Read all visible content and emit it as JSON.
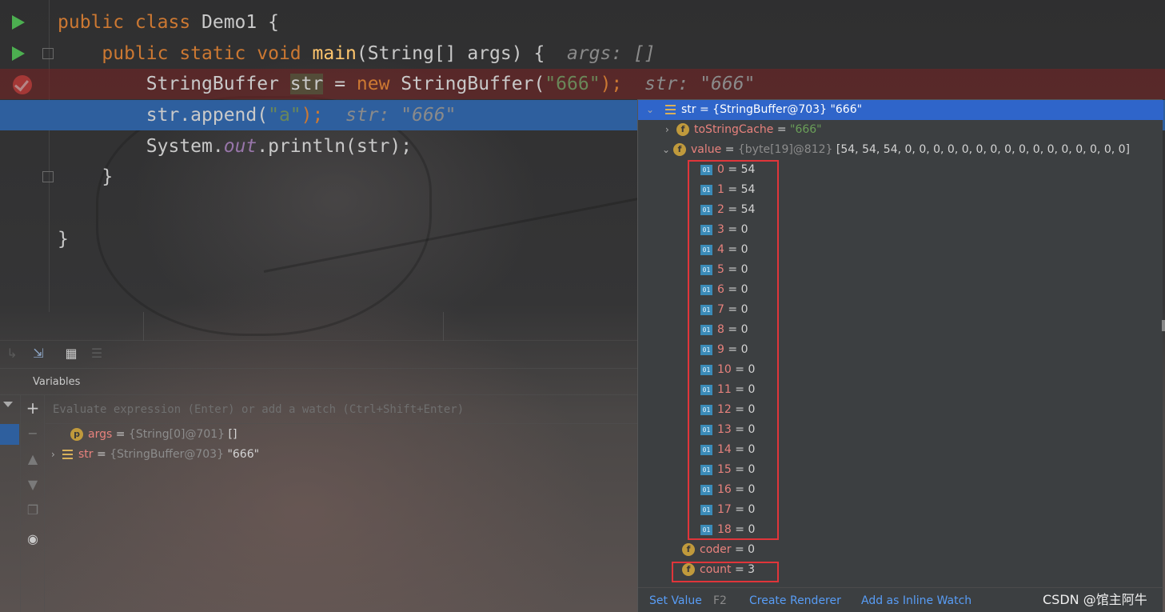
{
  "editor": {
    "lines": [
      {
        "p1": "public class ",
        "p2": "Demo1",
        "p3": " {"
      },
      {
        "p1": "    public static void ",
        "p2": "main",
        "p3": "(String[] args) {",
        "hint": "  args: []"
      },
      {
        "p1": "        StringBuffer ",
        "var": "str",
        "p2": " = ",
        "kw": "new",
        "p3": " StringBuffer(",
        "s": "\"666\"",
        "p4": ");",
        "hint": "  str: \"666\""
      },
      {
        "p1": "        str.append(",
        "s": "\"a\"",
        "p2": ");",
        "hint": "  str: \"666\""
      },
      {
        "p1": "        System.",
        "static": "out",
        "p2": ".println(str);"
      },
      {
        "p1": "    }"
      },
      {
        "p1": ""
      },
      {
        "p1": "}"
      }
    ]
  },
  "debugger": {
    "variables_title": "Variables",
    "eval_placeholder": "Evaluate expression (Enter) or add a watch (Ctrl+Shift+Enter)",
    "vars": [
      {
        "badge": "p",
        "name": "args",
        "type": "{String[0]@701}",
        "value": "[]"
      },
      {
        "name": "str",
        "type": "{StringBuffer@703}",
        "value": "\"666\""
      }
    ]
  },
  "popup": {
    "header": {
      "name": "str",
      "rest": " = {StringBuffer@703} \"666\""
    },
    "toStringCache": {
      "badge": "f",
      "name": "toStringCache",
      "eq": " = ",
      "value": "\"666\""
    },
    "value": {
      "badge": "f",
      "name": "value",
      "eq": " = ",
      "type": "{byte[19]@812}",
      "items": "[54, 54, 54, 0, 0, 0, 0, 0, 0, 0, 0, 0, 0, 0, 0, 0, 0, 0, 0]"
    },
    "elements": [
      {
        "idx": "0",
        "val": "54"
      },
      {
        "idx": "1",
        "val": "54"
      },
      {
        "idx": "2",
        "val": "54"
      },
      {
        "idx": "3",
        "val": "0"
      },
      {
        "idx": "4",
        "val": "0"
      },
      {
        "idx": "5",
        "val": "0"
      },
      {
        "idx": "6",
        "val": "0"
      },
      {
        "idx": "7",
        "val": "0"
      },
      {
        "idx": "8",
        "val": "0"
      },
      {
        "idx": "9",
        "val": "0"
      },
      {
        "idx": "10",
        "val": "0"
      },
      {
        "idx": "11",
        "val": "0"
      },
      {
        "idx": "12",
        "val": "0"
      },
      {
        "idx": "13",
        "val": "0"
      },
      {
        "idx": "14",
        "val": "0"
      },
      {
        "idx": "15",
        "val": "0"
      },
      {
        "idx": "16",
        "val": "0"
      },
      {
        "idx": "17",
        "val": "0"
      },
      {
        "idx": "18",
        "val": "0"
      }
    ],
    "coder": {
      "badge": "f",
      "name": "coder",
      "eq": " = ",
      "value": "0"
    },
    "count": {
      "badge": "f",
      "name": "count",
      "eq": " = ",
      "value": "3"
    },
    "element_icon_label": "01",
    "eq": " = ",
    "footer": {
      "set_value": "Set Value",
      "set_value_key": "F2",
      "create_renderer": "Create Renderer",
      "add_inline_watch": "Add as Inline Watch"
    }
  },
  "watermark": "CSDN @馆主阿牛",
  "colors": {
    "keyword": "#cc7832",
    "function": "#ffc66d",
    "string": "#6a8759",
    "selection": "#2e5f9e",
    "popup_header": "#2f65ca",
    "highlight_box": "#e0353a",
    "link": "#589df6"
  }
}
